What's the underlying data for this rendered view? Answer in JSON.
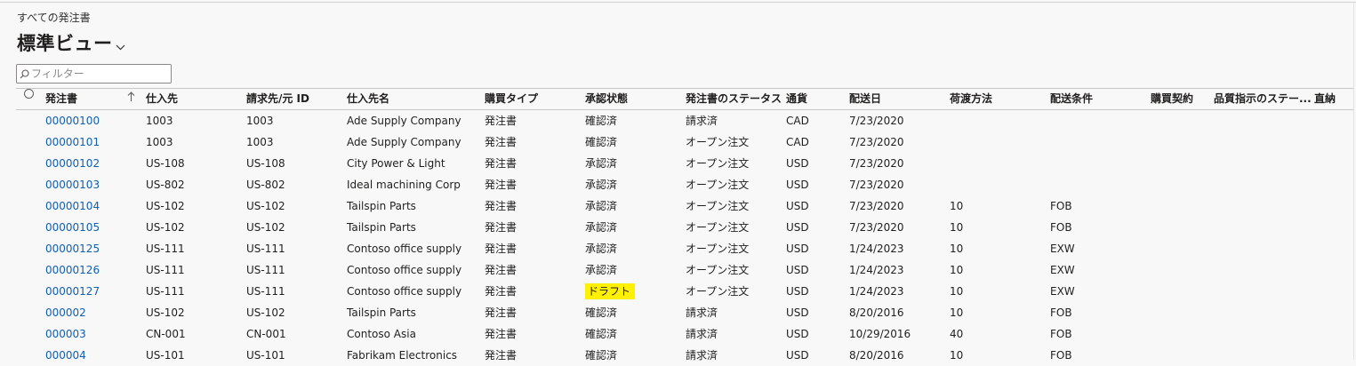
{
  "breadcrumb": "すべての発注書",
  "view_title": "標準ビュー",
  "filter": {
    "placeholder": "フィルター"
  },
  "columns": [
    "発注書",
    "仕入先",
    "請求先/元 ID",
    "仕入先名",
    "購買タイプ",
    "承認状態",
    "発注書のステータス",
    "通貨",
    "配送日",
    "荷渡方法",
    "配送条件",
    "購買契約",
    "品質指示のステー...",
    "直納"
  ],
  "rows": [
    [
      "00000100",
      "1003",
      "1003",
      "Ade Supply Company",
      "発注書",
      "確認済",
      "請求済",
      "CAD",
      "7/23/2020",
      "",
      ""
    ],
    [
      "00000101",
      "1003",
      "1003",
      "Ade Supply Company",
      "発注書",
      "確認済",
      "オープン注文",
      "CAD",
      "7/23/2020",
      "",
      ""
    ],
    [
      "00000102",
      "US-108",
      "US-108",
      "City Power & Light",
      "発注書",
      "承認済",
      "オープン注文",
      "USD",
      "7/23/2020",
      "",
      ""
    ],
    [
      "00000103",
      "US-802",
      "US-802",
      "Ideal machining Corp",
      "発注書",
      "承認済",
      "オープン注文",
      "USD",
      "7/23/2020",
      "",
      ""
    ],
    [
      "00000104",
      "US-102",
      "US-102",
      "Tailspin Parts",
      "発注書",
      "承認済",
      "オープン注文",
      "USD",
      "7/23/2020",
      "10",
      "FOB"
    ],
    [
      "00000105",
      "US-102",
      "US-102",
      "Tailspin Parts",
      "発注書",
      "承認済",
      "オープン注文",
      "USD",
      "7/23/2020",
      "10",
      "FOB"
    ],
    [
      "00000125",
      "US-111",
      "US-111",
      "Contoso office supply",
      "発注書",
      "承認済",
      "オープン注文",
      "USD",
      "1/24/2023",
      "10",
      "EXW"
    ],
    [
      "00000126",
      "US-111",
      "US-111",
      "Contoso office supply",
      "発注書",
      "承認済",
      "オープン注文",
      "USD",
      "1/24/2023",
      "10",
      "EXW"
    ],
    [
      "00000127",
      "US-111",
      "US-111",
      "Contoso office supply",
      "発注書",
      "ドラフト",
      "オープン注文",
      "USD",
      "1/24/2023",
      "10",
      "EXW"
    ],
    [
      "000002",
      "US-102",
      "US-102",
      "Tailspin Parts",
      "発注書",
      "確認済",
      "請求済",
      "USD",
      "8/20/2016",
      "10",
      "FOB"
    ],
    [
      "000003",
      "CN-001",
      "CN-001",
      "Contoso Asia",
      "発注書",
      "確認済",
      "請求済",
      "USD",
      "10/29/2016",
      "40",
      "FOB"
    ],
    [
      "000004",
      "US-101",
      "US-101",
      "Fabrikam Electronics",
      "発注書",
      "確認済",
      "請求済",
      "USD",
      "8/20/2016",
      "10",
      "FOB"
    ]
  ],
  "highlighted_value": "ドラフト",
  "colors": {
    "link": "#0f5fb3",
    "highlight": "#fff100",
    "background": "#f8f8f8"
  }
}
